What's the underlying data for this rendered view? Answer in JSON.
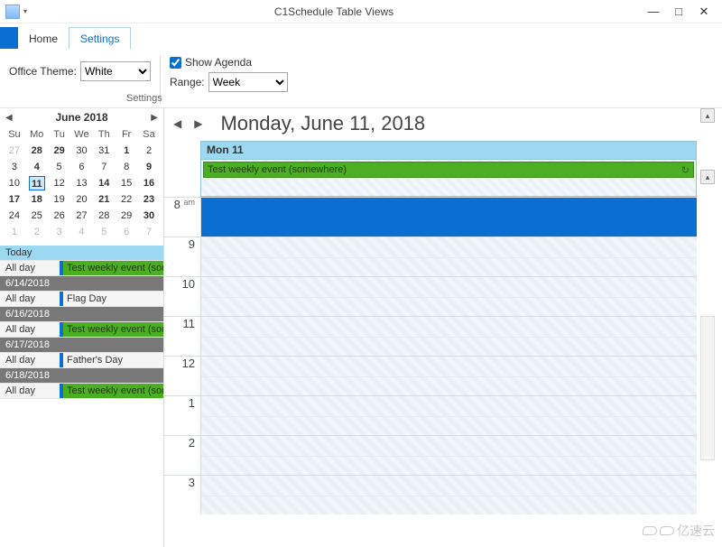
{
  "window": {
    "title": "C1Schedule Table Views",
    "min": "—",
    "max": "□",
    "close": "✕"
  },
  "ribbon": {
    "home": "Home",
    "settings": "Settings",
    "theme_label": "Office Theme:",
    "theme_value": "White",
    "show_agenda": "Show Agenda",
    "range_label": "Range:",
    "range_value": "Week",
    "group_label": "Settings"
  },
  "calendar": {
    "month_label": "June  2018",
    "dow": [
      "Su",
      "Mo",
      "Tu",
      "We",
      "Th",
      "Fr",
      "Sa"
    ],
    "rows": [
      [
        {
          "d": "27",
          "o": 1
        },
        {
          "d": "28",
          "b": 1
        },
        {
          "d": "29",
          "b": 1
        },
        {
          "d": "30",
          "o": 0
        },
        {
          "d": "31",
          "o": 0
        },
        {
          "d": "1",
          "b": 1
        },
        {
          "d": "2",
          "o": 0
        }
      ],
      [
        {
          "d": "3"
        },
        {
          "d": "4",
          "b": 1
        },
        {
          "d": "5"
        },
        {
          "d": "6"
        },
        {
          "d": "7"
        },
        {
          "d": "8"
        },
        {
          "d": "9",
          "b": 1
        }
      ],
      [
        {
          "d": "10"
        },
        {
          "d": "11",
          "b": 1,
          "sel": 1
        },
        {
          "d": "12"
        },
        {
          "d": "13"
        },
        {
          "d": "14",
          "b": 1
        },
        {
          "d": "15"
        },
        {
          "d": "16",
          "b": 1
        }
      ],
      [
        {
          "d": "17",
          "b": 1
        },
        {
          "d": "18",
          "b": 1
        },
        {
          "d": "19"
        },
        {
          "d": "20"
        },
        {
          "d": "21",
          "b": 1
        },
        {
          "d": "22"
        },
        {
          "d": "23",
          "b": 1
        }
      ],
      [
        {
          "d": "24"
        },
        {
          "d": "25"
        },
        {
          "d": "26"
        },
        {
          "d": "27"
        },
        {
          "d": "28"
        },
        {
          "d": "29"
        },
        {
          "d": "30",
          "b": 1
        }
      ],
      [
        {
          "d": "1",
          "o": 1
        },
        {
          "d": "2",
          "o": 1
        },
        {
          "d": "3",
          "o": 1
        },
        {
          "d": "4",
          "o": 1
        },
        {
          "d": "5",
          "o": 1
        },
        {
          "d": "6",
          "o": 1
        },
        {
          "d": "7",
          "o": 1
        }
      ]
    ]
  },
  "agenda": {
    "today": "Today",
    "allday": "All day",
    "items": [
      {
        "type": "ev",
        "label": "All day",
        "text": "Test weekly event (som",
        "green": 1
      },
      {
        "type": "hdr",
        "date": "6/14/2018"
      },
      {
        "type": "ev",
        "label": "All day",
        "text": "Flag Day",
        "green": 0
      },
      {
        "type": "hdr",
        "date": "6/16/2018"
      },
      {
        "type": "ev",
        "label": "All day",
        "text": "Test weekly event (som",
        "green": 1
      },
      {
        "type": "hdr",
        "date": "6/17/2018"
      },
      {
        "type": "ev",
        "label": "All day",
        "text": "Father's Day",
        "green": 0
      },
      {
        "type": "hdr",
        "date": "6/18/2018"
      },
      {
        "type": "ev",
        "label": "All day",
        "text": "Test weekly event (som",
        "green": 1
      }
    ]
  },
  "dayview": {
    "title": "Monday, June 11, 2018",
    "dow_header": "Mon 11",
    "allday_event": "Test weekly event (somewhere)",
    "hours": [
      {
        "h": "8",
        "ampm": "am",
        "first": 1
      },
      {
        "h": "9"
      },
      {
        "h": "10"
      },
      {
        "h": "11"
      },
      {
        "h": "12"
      },
      {
        "h": "1"
      },
      {
        "h": "2"
      },
      {
        "h": "3"
      }
    ]
  },
  "watermark": "亿速云"
}
